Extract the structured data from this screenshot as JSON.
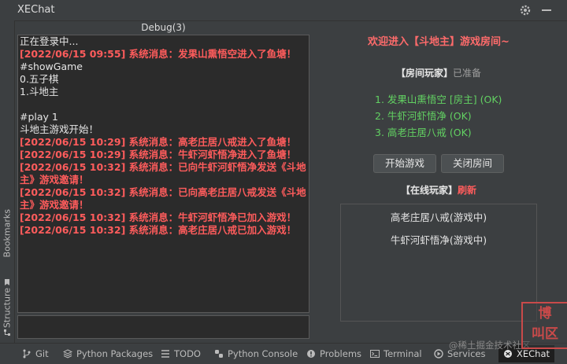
{
  "window": {
    "title": "XEChat"
  },
  "side_tabs": {
    "bookmarks": "Bookmarks",
    "structure": "Structure"
  },
  "debug": {
    "header": "Debug(3)",
    "lines": [
      {
        "text": "正在登录中...",
        "type": "normal"
      },
      {
        "text": "[2022/06/15 09:55] 系统消息：发果山熏悟空进入了鱼塘！",
        "type": "sys"
      },
      {
        "text": "#showGame",
        "type": "normal"
      },
      {
        "text": "0.五子棋",
        "type": "normal"
      },
      {
        "text": "1.斗地主",
        "type": "normal"
      },
      {
        "text": " ",
        "type": "normal"
      },
      {
        "text": "#play 1",
        "type": "normal"
      },
      {
        "text": "斗地主游戏开始！",
        "type": "normal"
      },
      {
        "text": "[2022/06/15 10:29] 系统消息：高老庄居八戒进入了鱼塘！",
        "type": "sys"
      },
      {
        "text": "[2022/06/15 10:29] 系统消息：牛虾河虾悟净进入了鱼塘！",
        "type": "sys"
      },
      {
        "text": "[2022/06/15 10:32] 系统消息：已向牛虾河虾悟净发送《斗地主》游戏邀请！",
        "type": "sys"
      },
      {
        "text": "[2022/06/15 10:32] 系统消息：已向高老庄居八戒发送《斗地主》游戏邀请！",
        "type": "sys"
      },
      {
        "text": "[2022/06/15 10:32] 系统消息：牛虾河虾悟净已加入游戏！",
        "type": "sys"
      },
      {
        "text": "[2022/06/15 10:32] 系统消息：高老庄居八戒已加入游戏！",
        "type": "sys"
      }
    ]
  },
  "room": {
    "welcome": "欢迎进入【斗地主】游戏房间~",
    "players_label": "【房间玩家】",
    "players_status": "已准备",
    "players": [
      "1. 发果山熏悟空 [房主] (OK)",
      "2. 牛虾河虾悟净 (OK)",
      "3. 高老庄居八戒 (OK)"
    ],
    "start_button": "开始游戏",
    "close_button": "关闭房间",
    "online_label": "【在线玩家】",
    "refresh_label": "刷新",
    "online": [
      "高老庄居八戒(游戏中)",
      "牛虾河虾悟净(游戏中)"
    ]
  },
  "toolbar": {
    "git": "Git",
    "python_packages": "Python Packages",
    "todo": "TODO",
    "python_console": "Python Console",
    "problems": "Problems",
    "terminal": "Terminal",
    "services": "Services",
    "xechat": "XEChat"
  },
  "watermark": "@稀土掘金技术社区",
  "stamp": "博\n叫区"
}
